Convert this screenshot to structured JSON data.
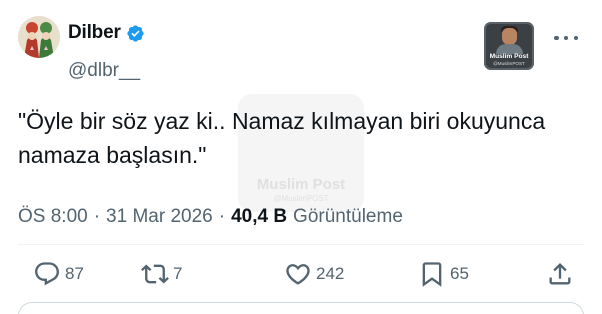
{
  "author": {
    "display_name": "Dilber",
    "handle": "@dlbr__",
    "verified": true,
    "verified_color": "#1d9bf0"
  },
  "source_logo": {
    "title": "Muslim Post",
    "subtitle": "@MuslimPOST"
  },
  "tweet": {
    "text": "\"Öyle bir söz yaz ki.. Namaz kılmayan biri okuyunca namaza başlasın.\""
  },
  "meta": {
    "time": "ÖS 8:00",
    "separator_1": "·",
    "date": "31 Mar 2026",
    "separator_2": "·",
    "views_count": "40,4 B",
    "views_label": "Görüntüleme"
  },
  "actions": {
    "replies": "87",
    "retweets": "7",
    "likes": "242",
    "bookmarks": "65"
  },
  "watermark": {
    "text": "Muslim Post",
    "subtext": "@MuslimPOST"
  },
  "icons": {
    "more": "more-horizontal-icon",
    "reply": "speech-bubble-icon",
    "retweet": "retweet-arrows-icon",
    "like": "heart-icon",
    "bookmark": "bookmark-icon",
    "share": "share-upload-icon"
  },
  "colors": {
    "text": "#0f1419",
    "secondary": "#536471",
    "divider": "#eff3f4"
  }
}
